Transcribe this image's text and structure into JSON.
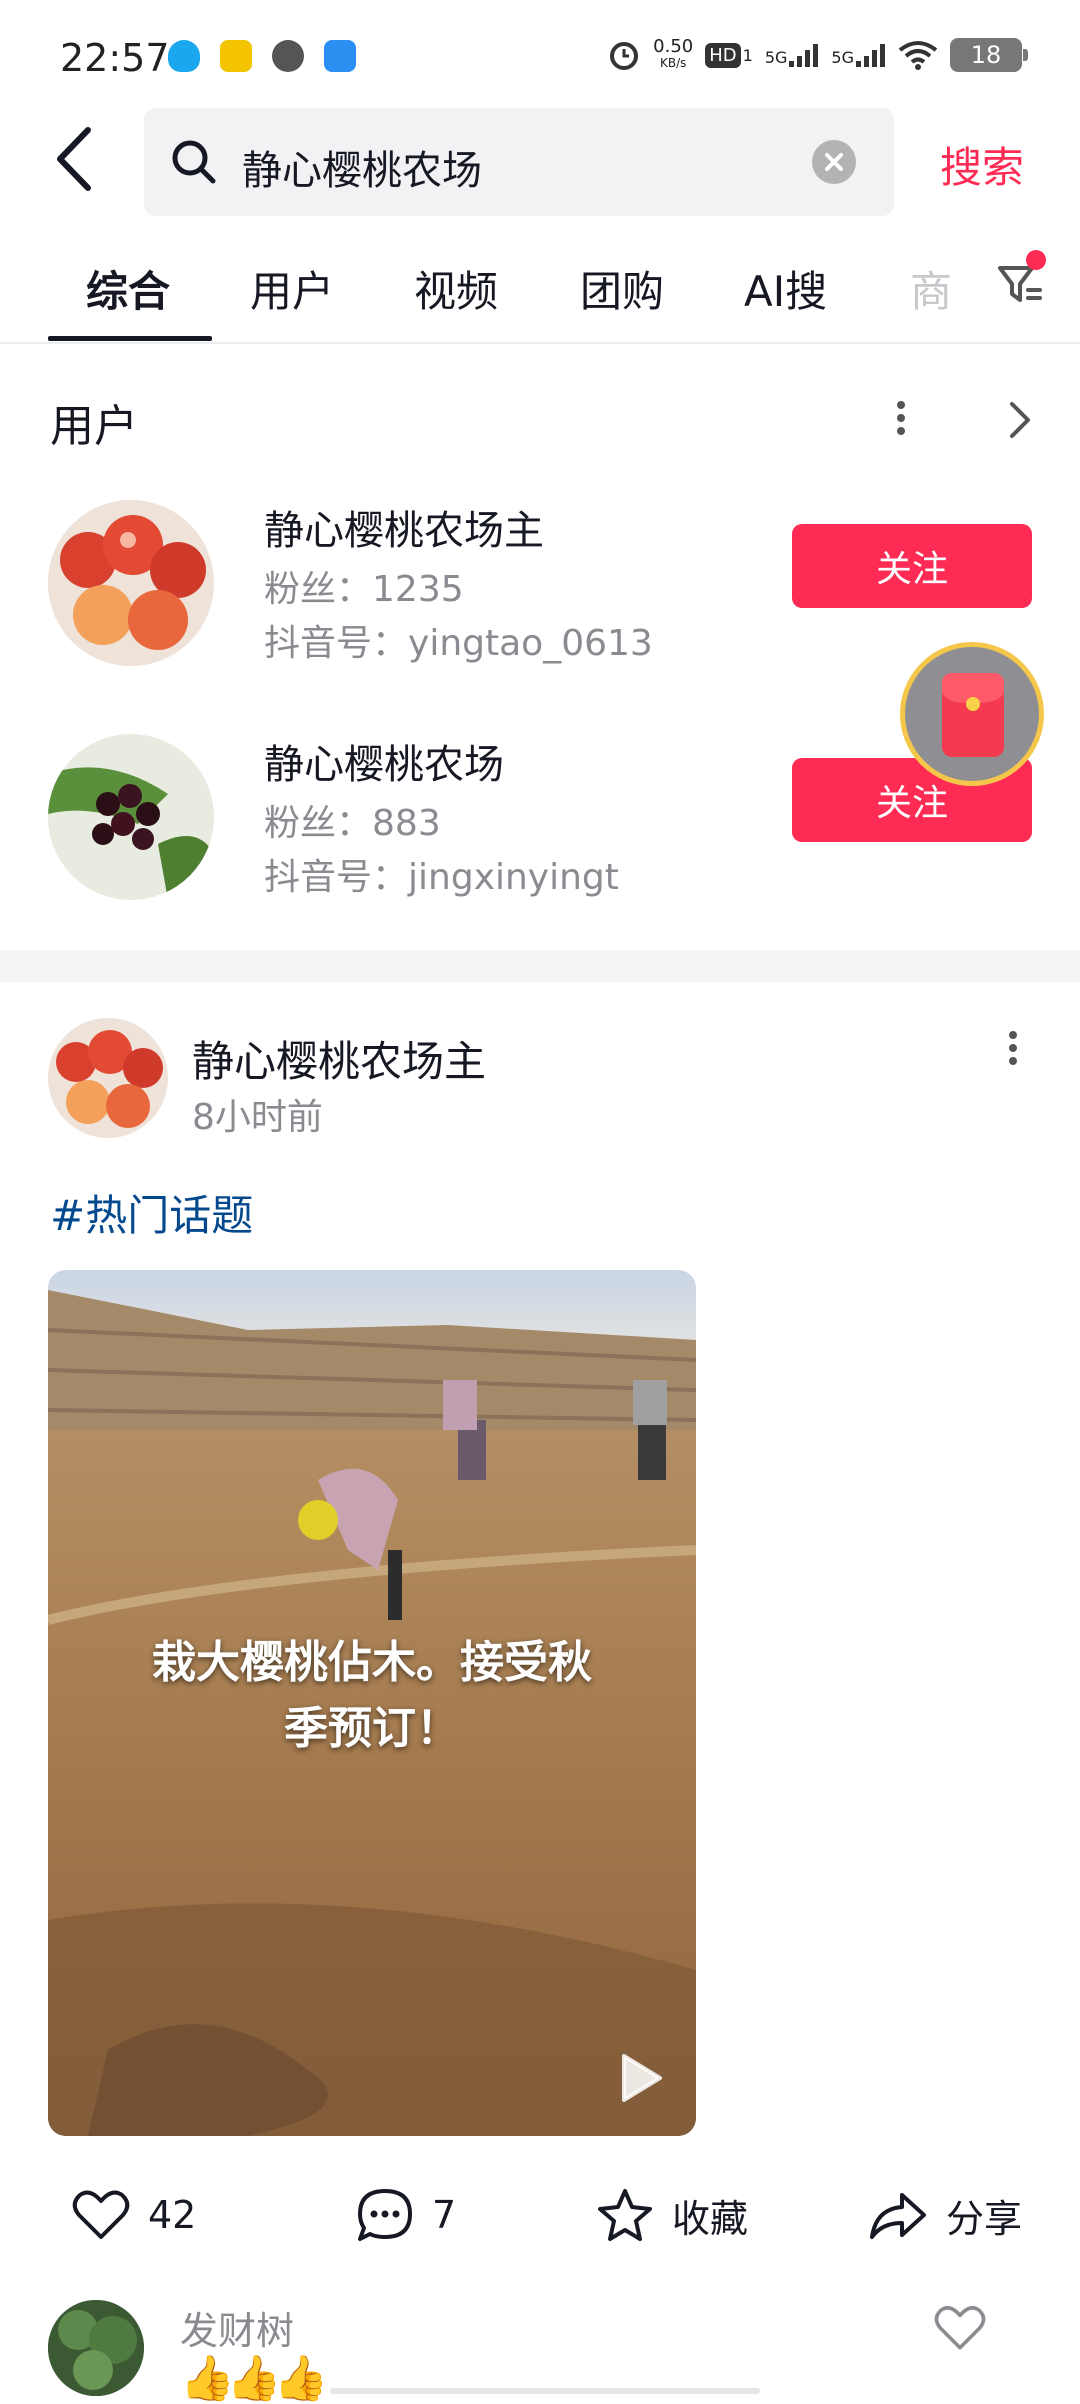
{
  "status_bar": {
    "time": "22:57",
    "net_speed": "0.50",
    "net_speed_unit": "KB/s",
    "sim1_label": "HD",
    "sim1_index": "1",
    "sim2_index": "2",
    "net_type_1": "5G",
    "net_type_2": "5G",
    "battery_level": "18",
    "icons": [
      "qq-icon",
      "kids-app-icon",
      "chat-bubble-icon",
      "browser-icon",
      "alarm-icon",
      "signal-icon",
      "wifi-icon",
      "battery-icon"
    ]
  },
  "search": {
    "query": "静心樱桃农场",
    "action_label": "搜索"
  },
  "tabs": [
    {
      "label": "综合",
      "active": true
    },
    {
      "label": "用户",
      "active": false
    },
    {
      "label": "视频",
      "active": false
    },
    {
      "label": "团购",
      "active": false
    },
    {
      "label": "AI搜",
      "active": false
    },
    {
      "label": "商",
      "active": false
    }
  ],
  "users_section": {
    "title": "用户",
    "users": [
      {
        "name": "静心樱桃农场主",
        "fans_label": "粉丝：",
        "fans": "1235",
        "id_label": "抖音号：",
        "douyin_id": "yingtao_0613",
        "follow_label": "关注"
      },
      {
        "name": "静心樱桃农场",
        "fans_label": "粉丝：",
        "fans": "883",
        "id_label": "抖音号：",
        "douyin_id": "jingxinyingt",
        "follow_label": "关注"
      }
    ]
  },
  "post": {
    "author": "静心樱桃农场主",
    "time": "8小时前",
    "hashtag": "#热门话题",
    "caption_line1": "栽大樱桃佔木。接受秋",
    "caption_line2": "季预订！",
    "likes": "42",
    "comments": "7",
    "favorite_label": "收藏",
    "share_label": "分享"
  },
  "top_comment": {
    "author": "发财树",
    "content": "👍👍👍"
  },
  "colors": {
    "accent": "#fe2c55",
    "hashtag": "#04498d",
    "secondary_text": "#8a8b91",
    "primary_text": "#161823"
  }
}
